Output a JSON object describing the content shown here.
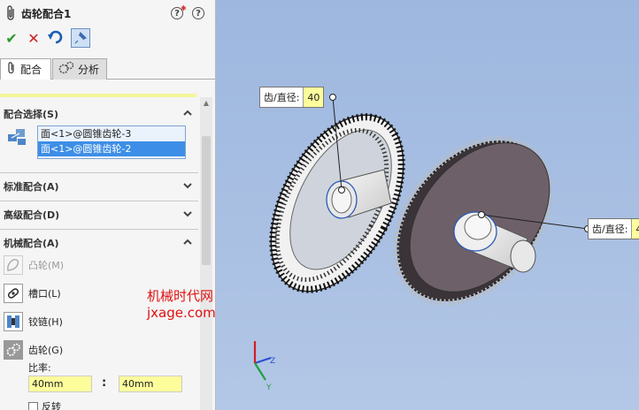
{
  "panel": {
    "title": "齿轮配合1",
    "tabs": [
      {
        "label": "配合"
      },
      {
        "label": "分析"
      }
    ],
    "sections": {
      "mate_selection": {
        "label": "配合选择(S)",
        "items": [
          "面<1>@圆锥齿轮-3",
          "面<1>@圆锥齿轮-2"
        ]
      },
      "standard": {
        "label": "标准配合(A)"
      },
      "advanced": {
        "label": "高级配合(D)"
      },
      "mechanical": {
        "label": "机械配合(A)",
        "items": [
          {
            "label": "凸轮(M)",
            "icon": "cam-icon",
            "enabled": false
          },
          {
            "label": "槽口(L)",
            "icon": "slot-icon",
            "enabled": true
          },
          {
            "label": "铰链(H)",
            "icon": "hinge-icon",
            "enabled": true
          },
          {
            "label": "齿轮(G)",
            "icon": "gear-icon",
            "enabled": true,
            "active": true
          }
        ]
      }
    },
    "ratio": {
      "label": "比率:",
      "left_value": "40mm",
      "separator": ":",
      "right_value": "40mm"
    },
    "reverse_label": "反转"
  },
  "viewport": {
    "callout_left": {
      "label": "齿/直径:",
      "value": "40"
    },
    "callout_right": {
      "label": "齿/直径:",
      "value": "4"
    },
    "axes": {
      "x": "X",
      "y": "Y",
      "z": "Z"
    }
  },
  "watermark": {
    "line1": "机械时代网",
    "line2": "jxage.com"
  },
  "colors": {
    "accent_yellow": "#fdfd9c",
    "selection_blue": "#3d8ee6",
    "viewport_bg": "#a9c0e3",
    "watermark_red": "#e01010"
  }
}
